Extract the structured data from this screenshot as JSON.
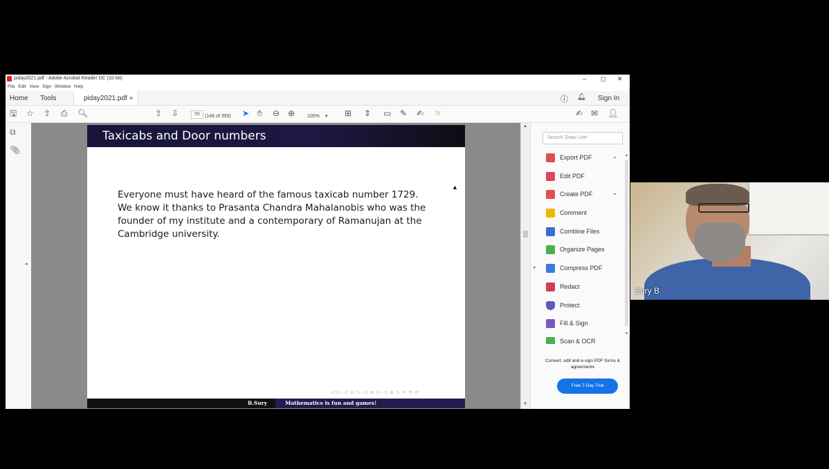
{
  "window": {
    "title": "piday2021.pdf - Adobe Acrobat Reader DC (32-bit)",
    "controls": {
      "minimize": "–",
      "maximize": "◻",
      "close": "✕"
    }
  },
  "menu": [
    "File",
    "Edit",
    "View",
    "Sign",
    "Window",
    "Help"
  ],
  "tabs": {
    "home": "Home",
    "tools": "Tools",
    "document": "piday2021.pdf",
    "close": "×",
    "sign_in": "Sign In"
  },
  "toolbar": {
    "page_number": "56",
    "page_count": "(148 of 395)",
    "zoom": "105%"
  },
  "slide": {
    "title": "Taxicabs and Door numbers",
    "lines": [
      "Everyone must have heard of the famous taxicab number 1729.",
      "We know it thanks to Prasanta Chandra Mahalanobis who was the",
      "founder of my institute and a contemporary of Ramanujan at the",
      "Cambridge university."
    ],
    "nav_symbols": "◁ ▷ ◁ ⊡ ▷ ◁ ≣ ▷ ◁ ≣ ▷  ≡  ⟲ ⟳",
    "footer_left": "B.Sury",
    "footer_right": "Mathematics is fun and games!"
  },
  "tools_pane": {
    "search_placeholder": "Search 'Draw Line'",
    "items": [
      {
        "label": "Export PDF",
        "color": "#d9534f",
        "has_chevron": true
      },
      {
        "label": "Edit PDF",
        "color": "#e0455f",
        "has_chevron": false
      },
      {
        "label": "Create PDF",
        "color": "#e24f4f",
        "has_chevron": true
      },
      {
        "label": "Comment",
        "color": "#f2b705",
        "has_chevron": false
      },
      {
        "label": "Combine Files",
        "color": "#3f6ad8",
        "has_chevron": false
      },
      {
        "label": "Organize Pages",
        "color": "#4fae4a",
        "has_chevron": false
      },
      {
        "label": "Compress PDF",
        "color": "#3c7be0",
        "has_chevron": false
      },
      {
        "label": "Redact",
        "color": "#d23c5a",
        "has_chevron": false
      },
      {
        "label": "Protect",
        "color": "#5c5cbf",
        "has_chevron": false
      },
      {
        "label": "Fill & Sign",
        "color": "#7b58c9",
        "has_chevron": false
      },
      {
        "label": "Scan & OCR",
        "color": "#4fae4a",
        "has_chevron": false
      }
    ],
    "promo_text": "Convert, edit and e-sign PDF forms & agreements",
    "trial_button": "Free 7-Day Trial"
  },
  "participant": {
    "name": "Sury B"
  },
  "colors": {
    "accent": "#1473e6",
    "slide_title_bg": "#1b1640",
    "slide_footer_right": "#241c4f"
  }
}
